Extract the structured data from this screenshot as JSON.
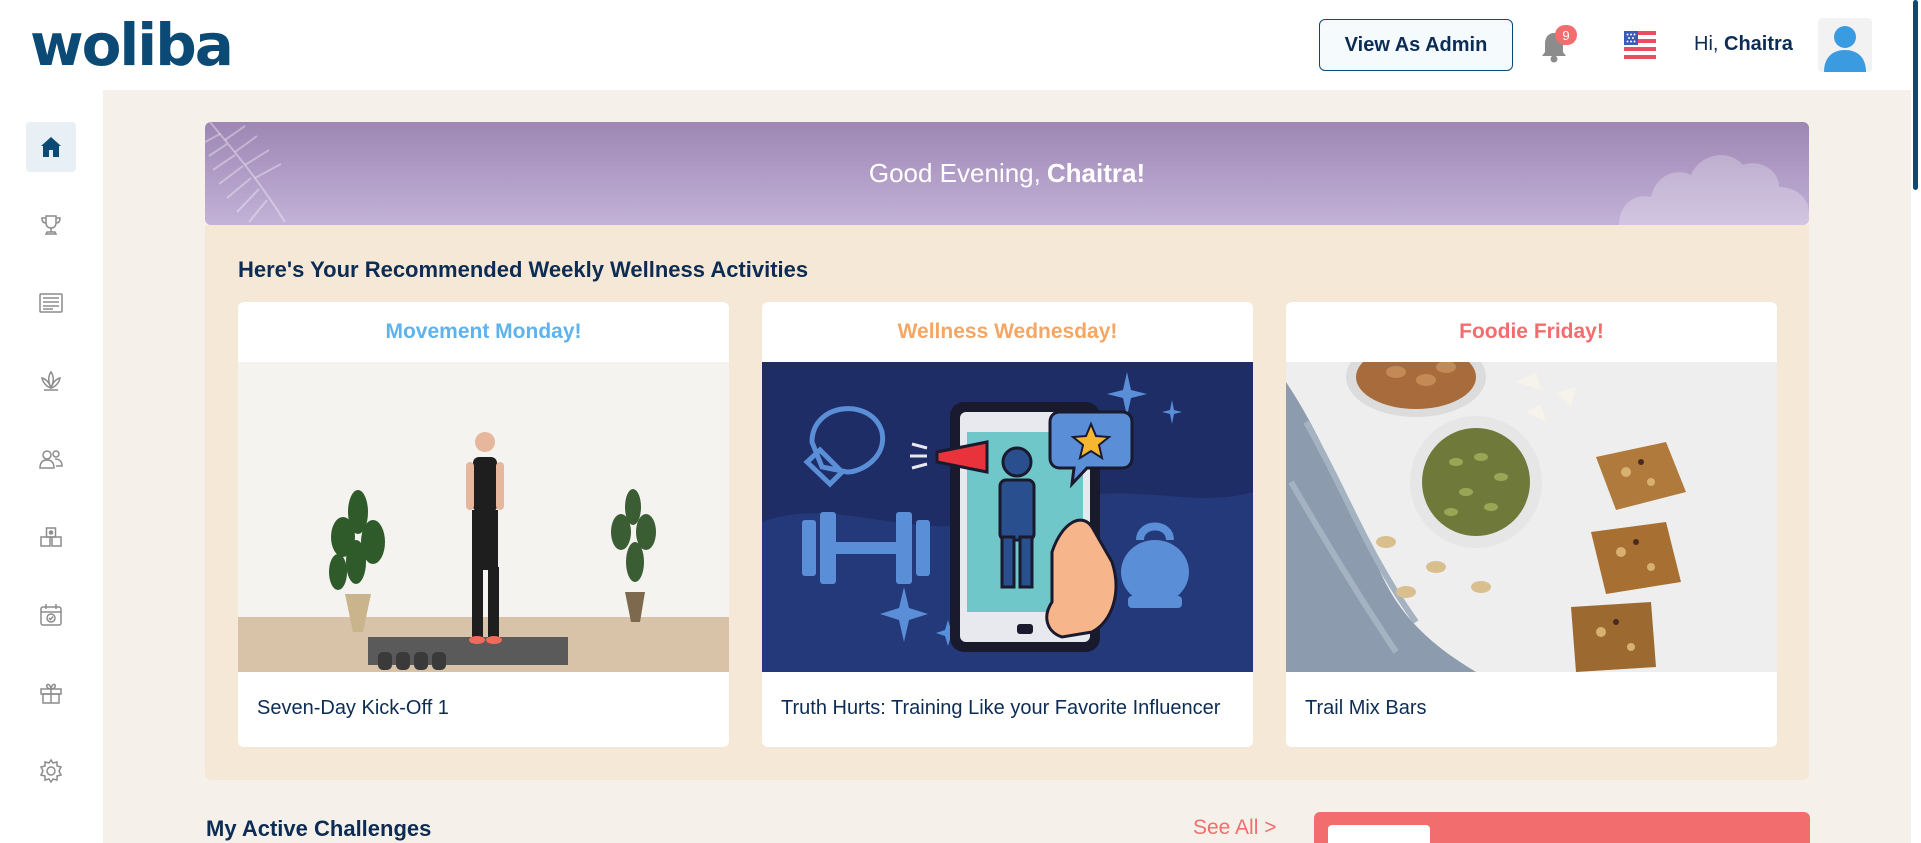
{
  "header": {
    "logo_text": "woliba",
    "admin_button": "View As Admin",
    "notification_count": "9",
    "greeting_prefix": "Hi,",
    "user_name": "Chaitra"
  },
  "sidebar": {
    "items": [
      {
        "name": "home",
        "icon": "home-icon",
        "active": true
      },
      {
        "name": "challenges",
        "icon": "trophy-icon",
        "active": false
      },
      {
        "name": "articles",
        "icon": "newspaper-icon",
        "active": false
      },
      {
        "name": "wellness",
        "icon": "lotus-icon",
        "active": false
      },
      {
        "name": "social",
        "icon": "people-icon",
        "active": false
      },
      {
        "name": "rewards",
        "icon": "medal-icon",
        "active": false
      },
      {
        "name": "events",
        "icon": "calendar-check-icon",
        "active": false
      },
      {
        "name": "gifts",
        "icon": "gift-icon",
        "active": false
      },
      {
        "name": "settings",
        "icon": "gear-icon",
        "active": false
      }
    ]
  },
  "banner": {
    "greeting": "Good Evening,",
    "name": "Chaitra!"
  },
  "weekly": {
    "title": "Here's Your Recommended Weekly Wellness Activities",
    "cards": [
      {
        "day": "Movement Monday!",
        "color": "#5eb3ec",
        "title": "Seven-Day Kick-Off 1"
      },
      {
        "day": "Wellness Wednesday!",
        "color": "#f5a664",
        "title": "Truth Hurts: Training Like your Favorite Influencer"
      },
      {
        "day": "Foodie Friday!",
        "color": "#f26d6d",
        "title": "Trail Mix Bars"
      }
    ]
  },
  "challenges": {
    "title": "My Active Challenges",
    "see_all": "See All >"
  },
  "colors": {
    "navy": "#0d2c54",
    "brand_blue": "#0b4a75",
    "coral": "#f26d6d",
    "banner_purple": "#9d86b3",
    "weekly_bg": "#f6e8d7"
  }
}
